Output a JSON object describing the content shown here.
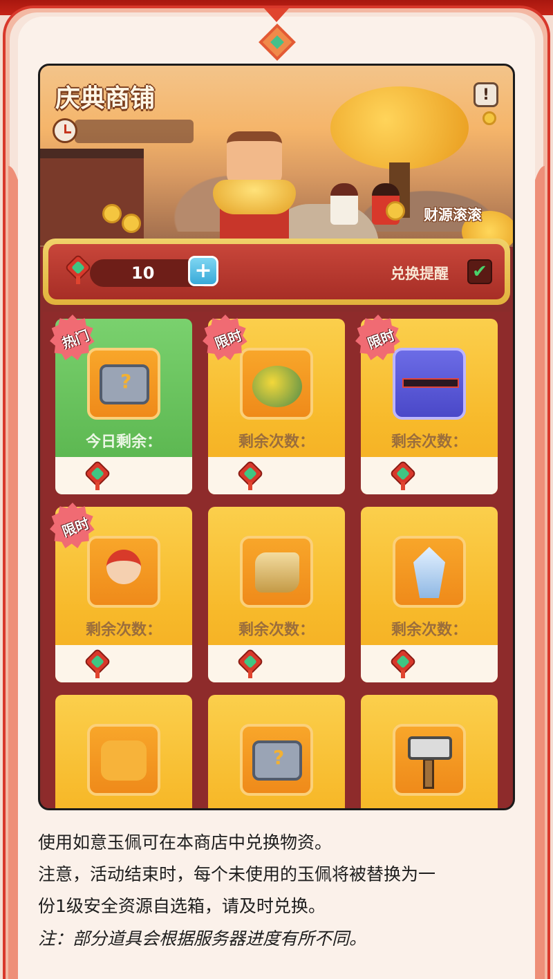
{
  "banner": {
    "title": "庆典商铺",
    "info_symbol": "!",
    "caption": "财源滚滚"
  },
  "currency": {
    "amount": "10",
    "plus_symbol": "+",
    "remind_label": "兑换提醒",
    "remind_check": "✔",
    "remind_checked": true
  },
  "items": [
    {
      "badge": "热门",
      "count_label": "今日剩余：",
      "icon": "chest-icon",
      "highlight": true
    },
    {
      "badge": "限时",
      "count_label": "剩余次数：",
      "icon": "island-decoration-icon",
      "highlight": false
    },
    {
      "badge": "限时",
      "count_label": "剩余次数：",
      "icon": "ship-skin-icon",
      "highlight": false
    },
    {
      "badge": "限时",
      "count_label": "剩余次数：",
      "icon": "character-icon",
      "highlight": false
    },
    {
      "badge": "",
      "count_label": "剩余次数：",
      "icon": "gold-ore-icon",
      "highlight": false
    },
    {
      "badge": "",
      "count_label": "剩余次数：",
      "icon": "crystal-icon",
      "highlight": false
    },
    {
      "badge": "",
      "count_label": "",
      "icon": "puzzle-piece-icon",
      "highlight": false
    },
    {
      "badge": "",
      "count_label": "",
      "icon": "chest-icon",
      "highlight": false
    },
    {
      "badge": "",
      "count_label": "",
      "icon": "hammer-icon",
      "highlight": false
    }
  ],
  "notes": {
    "line1": "使用如意玉佩可在本商店中兑换物资。",
    "line2": "注意，活动结束时，每个未使用的玉佩将被替换为一",
    "line3": "份1级安全资源自选箱，请及时兑换。",
    "remark": "注：部分道具会根据服务器进度有所不同。"
  },
  "colors": {
    "frame_red": "#d8382b",
    "card_gold": "#f7b92a",
    "card_green": "#55b14a",
    "badge_pink": "#f06b73"
  }
}
